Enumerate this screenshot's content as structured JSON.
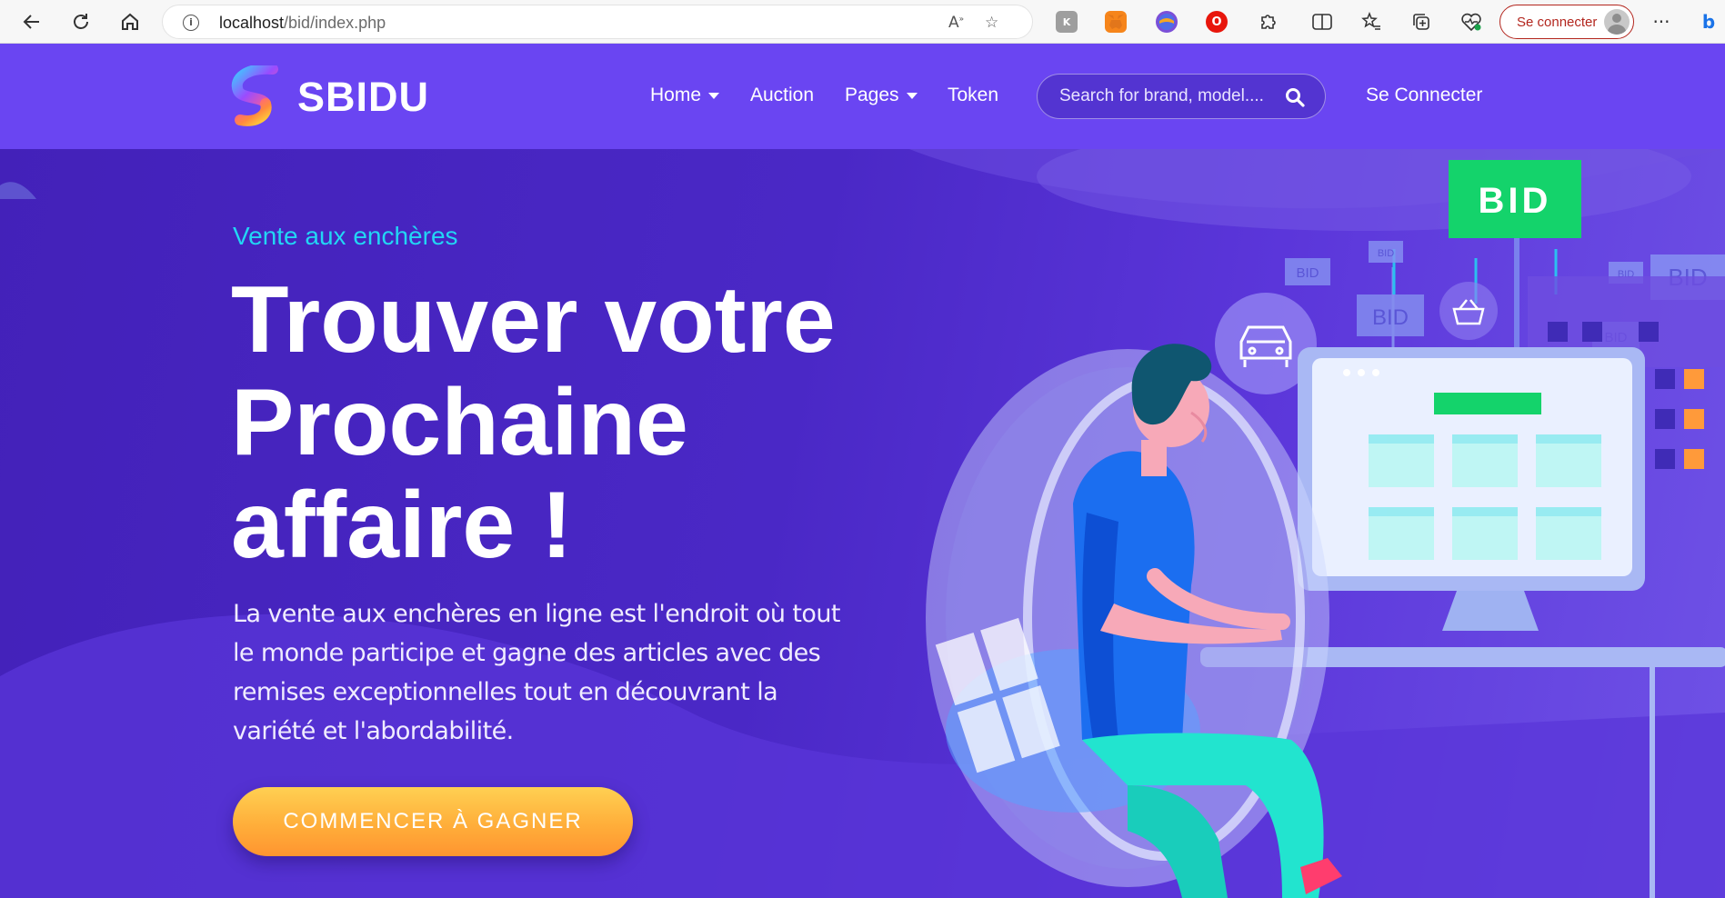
{
  "browser": {
    "url_host": "localhost",
    "url_path": "/bid/index.php",
    "signin_label": "Se connecter"
  },
  "site": {
    "brand": "SBIDU",
    "menu": [
      {
        "label": "Home",
        "has_caret": true
      },
      {
        "label": "Auction",
        "has_caret": false
      },
      {
        "label": "Pages",
        "has_caret": true
      },
      {
        "label": "Token",
        "has_caret": false
      }
    ],
    "search_placeholder": "Search for brand, model....",
    "login_label": "Se Connecter"
  },
  "hero": {
    "eyebrow": "Vente aux enchères",
    "headline": [
      "Trouver votre",
      "Prochaine",
      "affaire !"
    ],
    "lead": "La vente aux enchères en ligne est l'endroit où tout le monde participe et gagne des articles avec des remises exceptionnelles tout en découvrant la variété et l'abordabilité.",
    "cta_label": "COMMENCER À GAGNER",
    "illustration_labels": {
      "big_bid": "BID",
      "bid_tag": "BID"
    }
  },
  "colors": {
    "header_bg": "#6a45f2",
    "hero_bg": "#4a28c6",
    "eyebrow": "#22d6f4",
    "cta": "#ffae3a",
    "bid_green": "#14d36b"
  }
}
